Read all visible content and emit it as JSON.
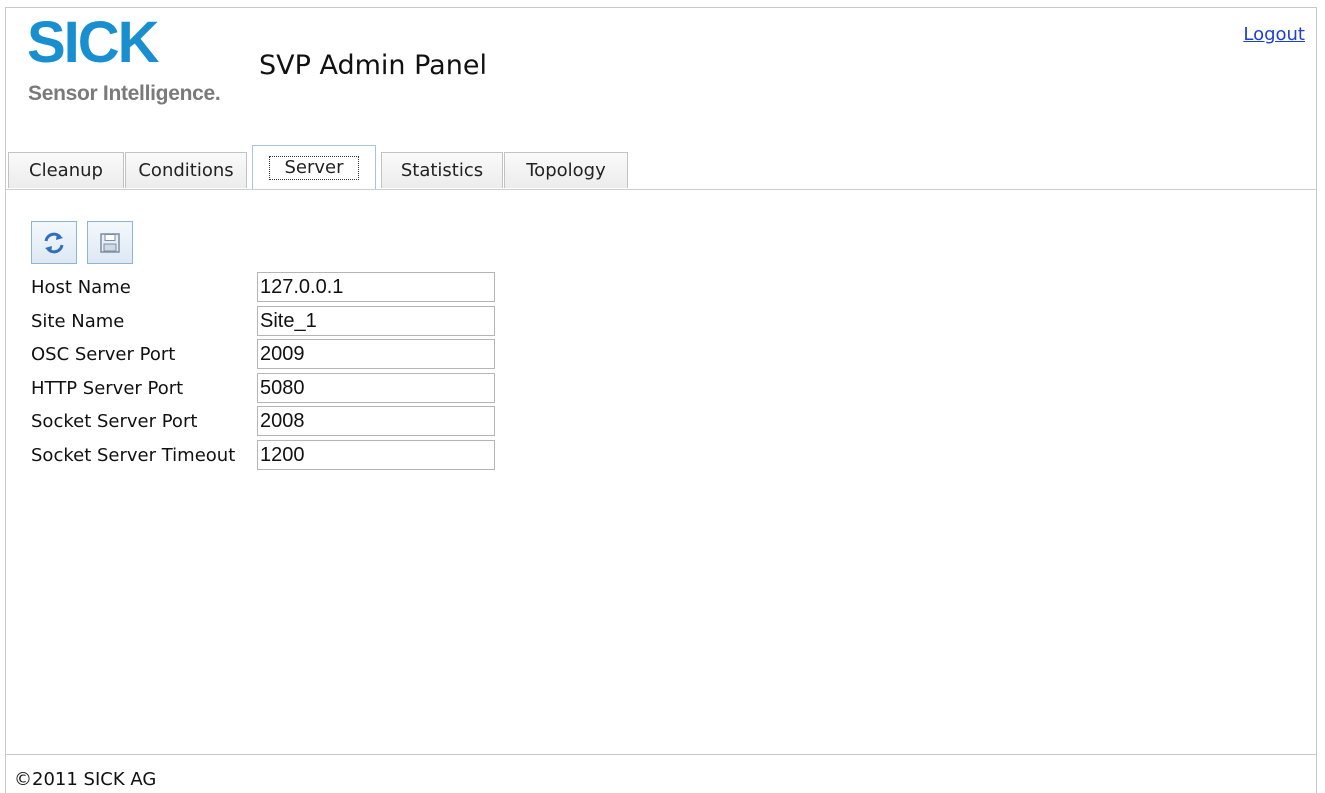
{
  "header": {
    "logo_word": "SICK",
    "logo_tagline": "Sensor Intelligence.",
    "app_title": "SVP Admin Panel",
    "logout_label": "Logout"
  },
  "tabs": [
    {
      "label": "Cleanup",
      "active": false
    },
    {
      "label": "Conditions",
      "active": false
    },
    {
      "label": "Server",
      "active": true
    },
    {
      "label": "Statistics",
      "active": false
    },
    {
      "label": "Topology",
      "active": false
    }
  ],
  "toolbar": {
    "refresh_icon": "refresh-icon",
    "save_icon": "floppy-disk-icon"
  },
  "form": {
    "fields": [
      {
        "label": "Host Name",
        "value": "127.0.0.1"
      },
      {
        "label": "Site Name",
        "value": "Site_1"
      },
      {
        "label": "OSC Server Port",
        "value": "2009"
      },
      {
        "label": "HTTP Server Port",
        "value": "5080"
      },
      {
        "label": "Socket Server Port",
        "value": "2008"
      },
      {
        "label": "Socket Server Timeout",
        "value": "1200"
      }
    ]
  },
  "footer": {
    "copyright": "©2011 SICK AG"
  },
  "colors": {
    "brand_blue": "#1a8fd0",
    "tagline_gray": "#7a7a7a",
    "link_blue": "#1d3ed8"
  }
}
